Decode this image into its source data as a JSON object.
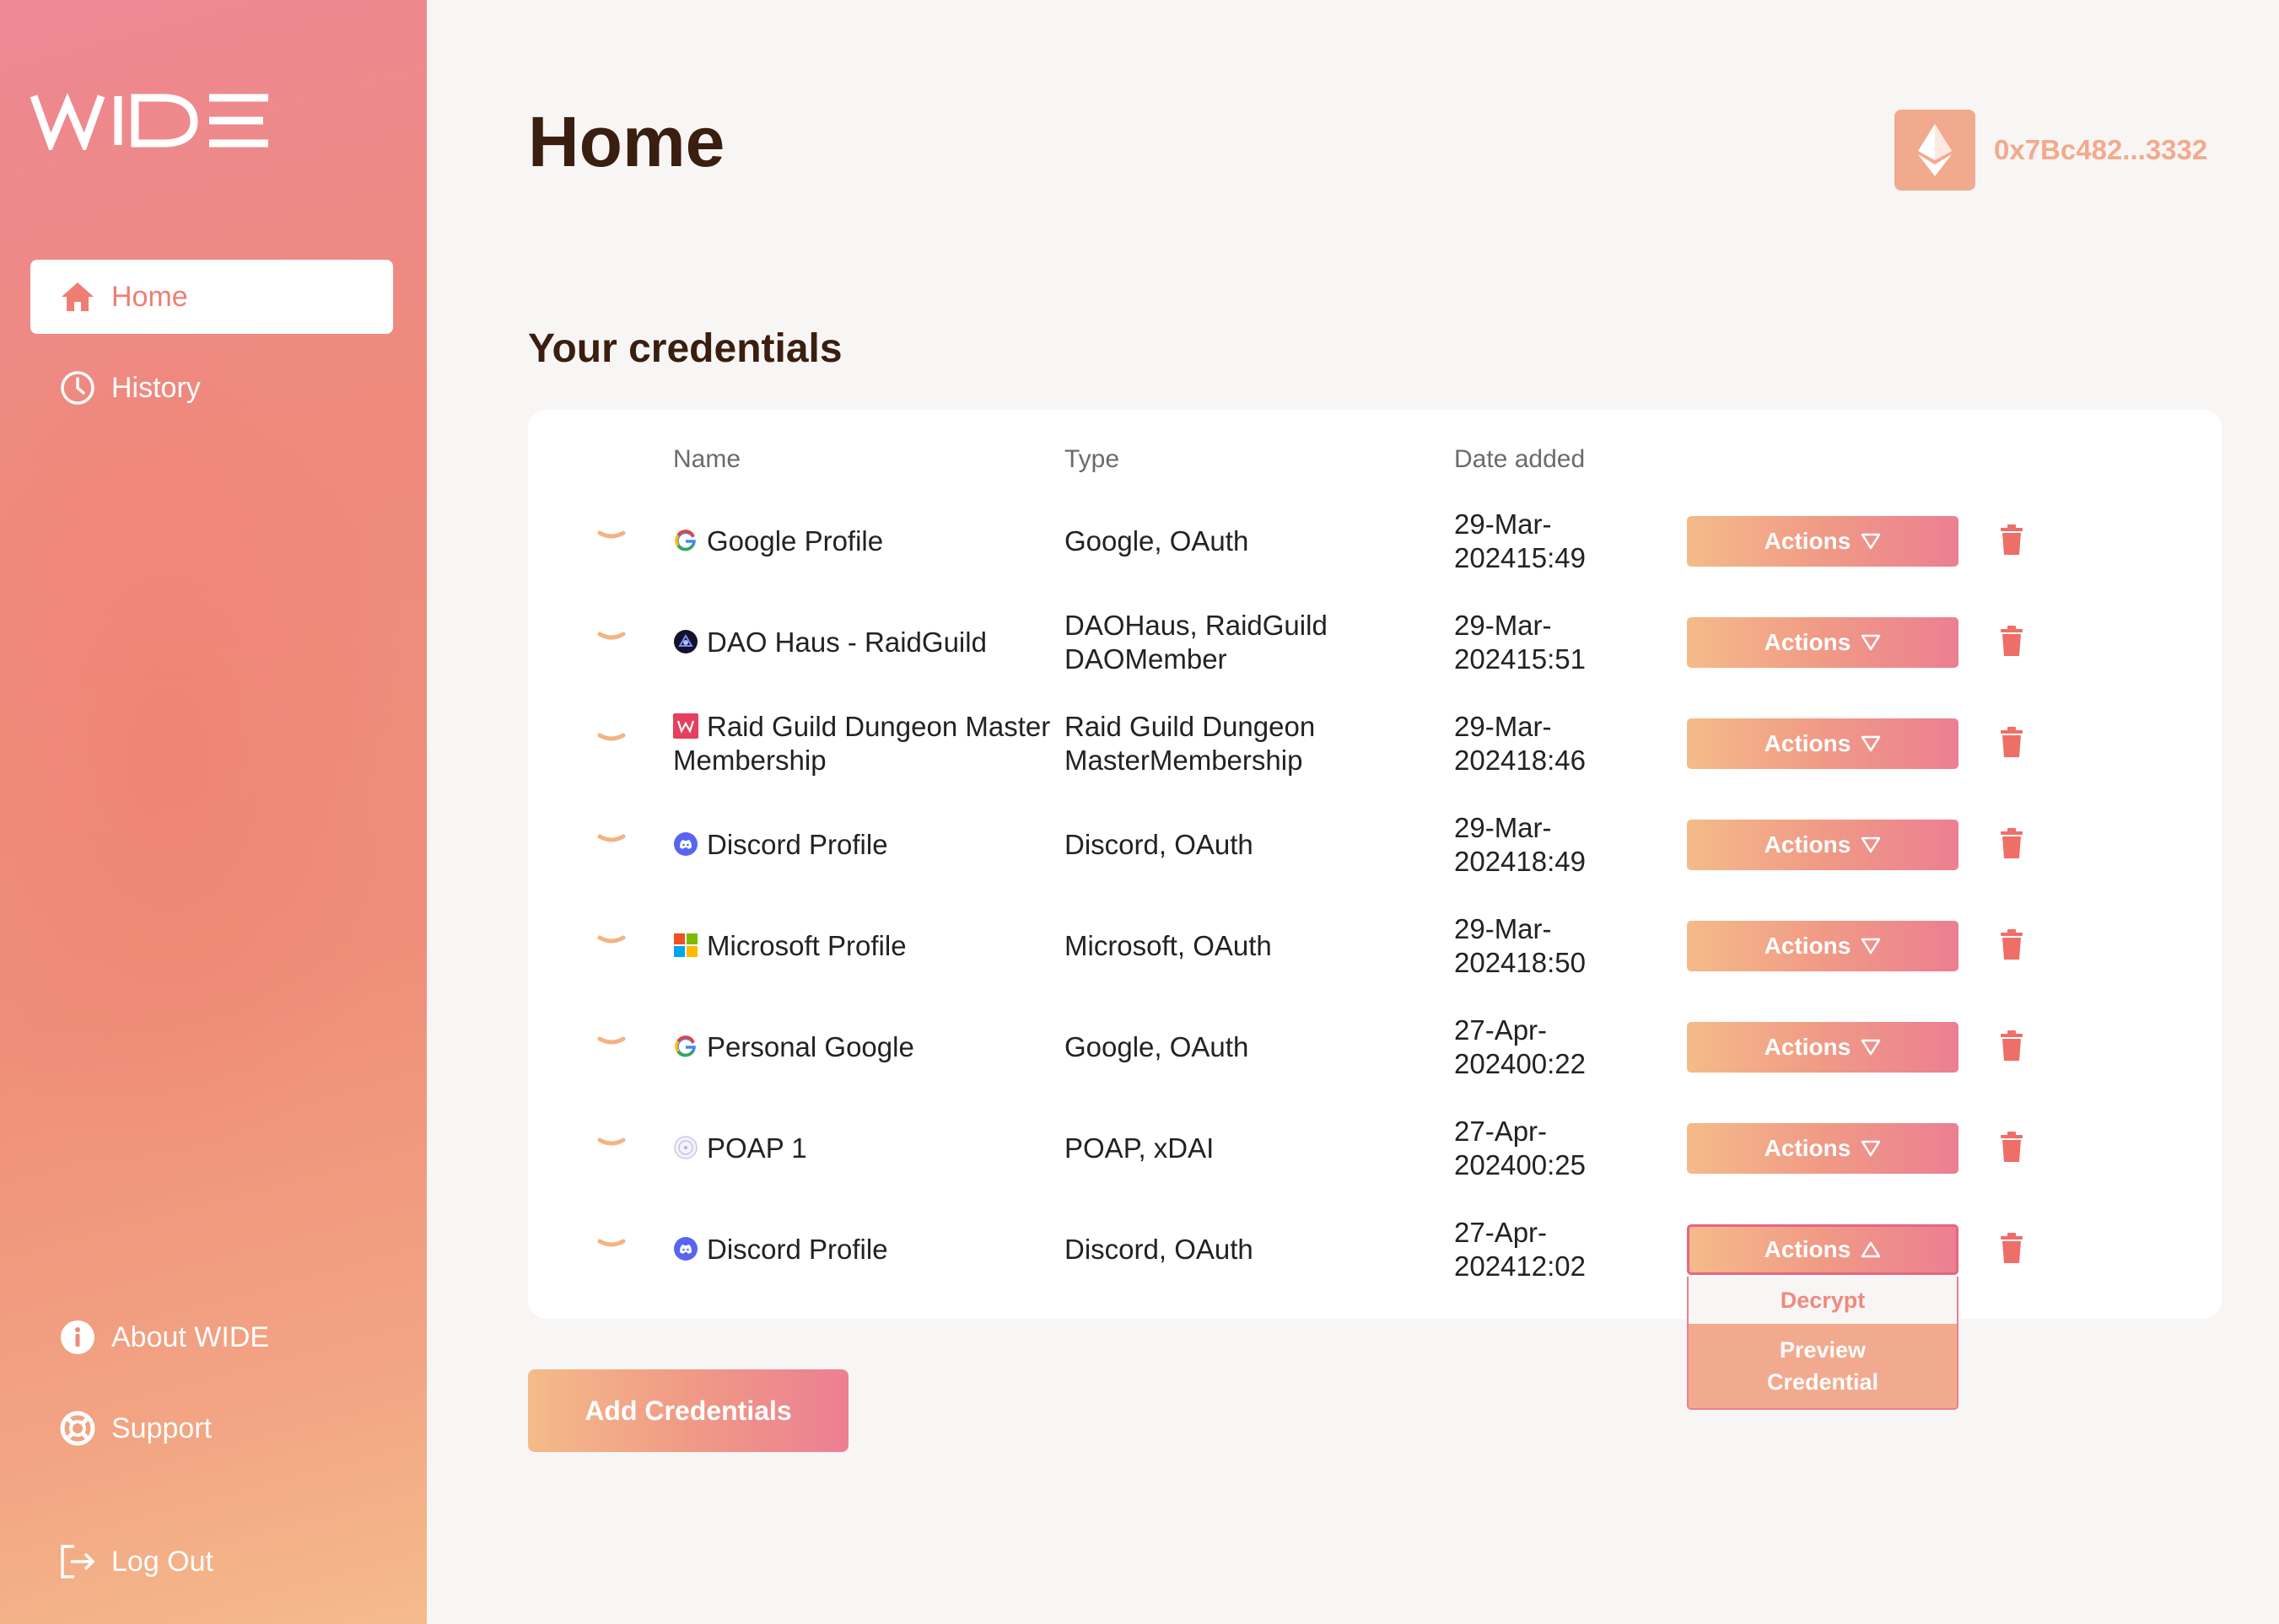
{
  "app": {
    "logo_text": "WIDE"
  },
  "sidebar": {
    "items": [
      {
        "label": "Home",
        "icon": "home-icon",
        "active": true
      },
      {
        "label": "History",
        "icon": "clock-icon"
      }
    ],
    "bottom_items": [
      {
        "label": "About WIDE",
        "icon": "info-icon"
      },
      {
        "label": "Support",
        "icon": "lifebuoy-icon"
      },
      {
        "label": "Log Out",
        "icon": "logout-icon"
      }
    ]
  },
  "header": {
    "title": "Home",
    "wallet_address": "0x7Bc482...3332",
    "wallet_icon": "ethereum-icon"
  },
  "credentials": {
    "title": "Your credentials",
    "columns": {
      "name": "Name",
      "type": "Type",
      "date": "Date added"
    },
    "rows": [
      {
        "name": "Google Profile",
        "icon": "google-icon",
        "type": "Google, OAuth",
        "date": "29-Mar-2024",
        "time": "15:49",
        "action": "Actions"
      },
      {
        "name": "DAO Haus - RaidGuild",
        "icon": "daohaus-icon",
        "type_line1": "DAOHaus, RaidGuild DAO",
        "type_line2": "Member",
        "date": "29-Mar-2024",
        "time": "15:51",
        "action": "Actions"
      },
      {
        "name_line1": "Raid Guild Dungeon Master",
        "name_line2": "Membership",
        "icon": "raidguild-icon",
        "type_line1": "Raid Guild Dungeon Master",
        "type_line2": "Membership",
        "date": "29-Mar-2024",
        "time": "18:46",
        "action": "Actions"
      },
      {
        "name": "Discord Profile",
        "icon": "discord-icon",
        "type": "Discord, OAuth",
        "date": "29-Mar-2024",
        "time": "18:49",
        "action": "Actions"
      },
      {
        "name": "Microsoft Profile",
        "icon": "microsoft-icon",
        "type": "Microsoft, OAuth",
        "date": "29-Mar-2024",
        "time": "18:50",
        "action": "Actions"
      },
      {
        "name": "Personal Google",
        "icon": "google-icon",
        "type": "Google, OAuth",
        "date": "27-Apr-2024",
        "time": "00:22",
        "action": "Actions"
      },
      {
        "name": "POAP 1",
        "icon": "poap-icon",
        "type": "POAP, xDAI",
        "date": "27-Apr-2024",
        "time": "00:25",
        "action": "Actions"
      },
      {
        "name": "Discord Profile",
        "icon": "discord-icon",
        "type": "Discord, OAuth",
        "date": "27-Apr-2024",
        "time": "12:02",
        "action": "Actions",
        "dropdown_open": true
      }
    ],
    "dropdown": {
      "decrypt": "Decrypt",
      "preview_line1": "Preview",
      "preview_line2": "Credential"
    },
    "add_button": "Add Credentials"
  },
  "colors": {
    "accent": "#ef7e72",
    "wallet": "#f2aa8e",
    "title": "#3a1e10",
    "trash": "#ee6f68"
  }
}
